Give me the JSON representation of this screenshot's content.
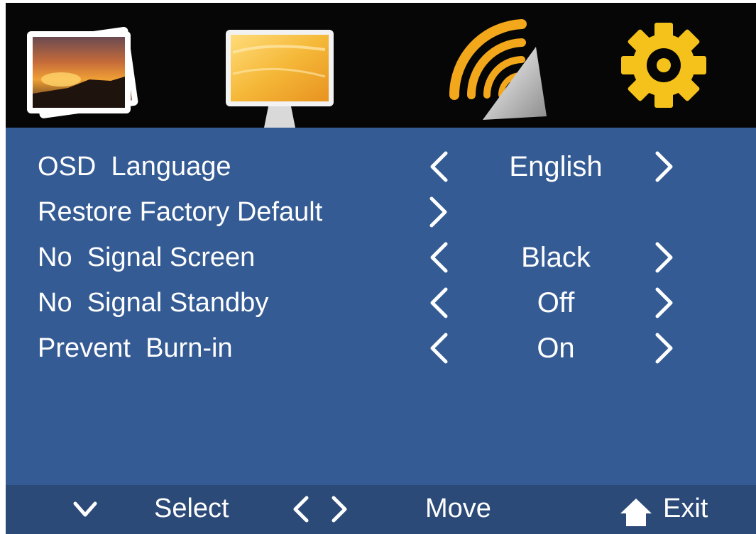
{
  "tabs": [
    {
      "icon": "picture-stack-icon",
      "selected": false
    },
    {
      "icon": "monitor-icon",
      "selected": false
    },
    {
      "icon": "signal-wave-icon",
      "selected": false
    },
    {
      "icon": "gear-icon",
      "selected": true
    }
  ],
  "colors": {
    "panel": "#345b94",
    "footer": "#2b4a78",
    "tabbar": "#060606",
    "accent": "#e9b91a",
    "text": "#ffffff"
  },
  "settings": {
    "rows": [
      {
        "label": "OSD  Language",
        "value": "English",
        "has_left_arrow": true,
        "has_right_arrow": true
      },
      {
        "label": "Restore Factory Default",
        "value": "",
        "has_left_arrow": false,
        "has_right_arrow": true
      },
      {
        "label": "No  Signal Screen",
        "value": "Black",
        "has_left_arrow": true,
        "has_right_arrow": true
      },
      {
        "label": "No  Signal Standby",
        "value": "Off",
        "has_left_arrow": true,
        "has_right_arrow": true
      },
      {
        "label": "Prevent  Burn-in",
        "value": "On",
        "has_left_arrow": true,
        "has_right_arrow": true
      }
    ]
  },
  "footer": {
    "select_label": "Select",
    "move_label": "Move",
    "exit_label": "Exit",
    "select_icon": "chevron-down-icon",
    "move_icons": [
      "chevron-left-icon",
      "chevron-right-icon"
    ],
    "exit_icon": "home-icon"
  }
}
